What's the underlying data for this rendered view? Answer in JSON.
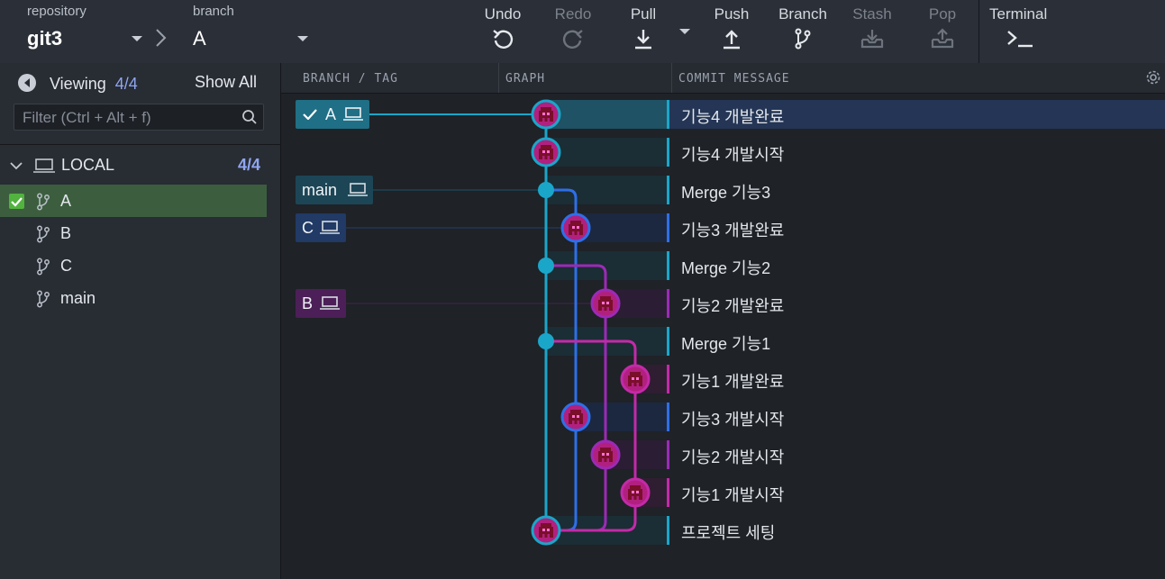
{
  "toolbar": {
    "repository_label": "repository",
    "repository_value": "git3",
    "branch_label": "branch",
    "branch_value": "A",
    "buttons": {
      "undo": "Undo",
      "redo": "Redo",
      "pull": "Pull",
      "push": "Push",
      "branch": "Branch",
      "stash": "Stash",
      "pop": "Pop",
      "terminal": "Terminal"
    }
  },
  "left_panel": {
    "viewing_label": "Viewing",
    "viewing_count": "4/4",
    "show_all": "Show All",
    "filter_placeholder": "Filter (Ctrl + Alt + f)",
    "local_label": "LOCAL",
    "local_count": "4/4",
    "branches": [
      {
        "name": "A",
        "checked": true
      },
      {
        "name": "B",
        "checked": false
      },
      {
        "name": "C",
        "checked": false
      },
      {
        "name": "main",
        "checked": false
      }
    ]
  },
  "graph_header": {
    "branch_tag": "BRANCH / TAG",
    "graph": "GRAPH",
    "commit_message": "COMMIT MESSAGE"
  },
  "refs": [
    {
      "label": "A",
      "checked": true,
      "color": "#1f6f86"
    },
    {
      "label": "main",
      "checked": false,
      "color": "#1c4656"
    },
    {
      "label": "C",
      "checked": false,
      "color": "#213a66"
    },
    {
      "label": "B",
      "checked": false,
      "color": "#4c1f58"
    }
  ],
  "commits": [
    {
      "message": "기능4 개발완료",
      "lane_color": "#1aa6c9",
      "selected": true
    },
    {
      "message": "기능4 개발시작",
      "lane_color": "#1aa6c9",
      "selected": false
    },
    {
      "message": "Merge 기능3",
      "lane_color": "#1aa6c9",
      "selected": false
    },
    {
      "message": "기능3 개발완료",
      "lane_color": "#2e6fe8",
      "selected": false
    },
    {
      "message": "Merge 기능2",
      "lane_color": "#1aa6c9",
      "selected": false
    },
    {
      "message": "기능2 개발완료",
      "lane_color": "#9c2ab6",
      "selected": false
    },
    {
      "message": "Merge 기능1",
      "lane_color": "#1aa6c9",
      "selected": false
    },
    {
      "message": "기능1 개발완료",
      "lane_color": "#c32aa8",
      "selected": false
    },
    {
      "message": "기능3 개발시작",
      "lane_color": "#2e6fe8",
      "selected": false
    },
    {
      "message": "기능2 개발시작",
      "lane_color": "#9c2ab6",
      "selected": false
    },
    {
      "message": "기능1 개발시작",
      "lane_color": "#c32aa8",
      "selected": false
    },
    {
      "message": "프로젝트 세팅",
      "lane_color": "#1aa6c9",
      "selected": false
    }
  ],
  "colors": {
    "main_lane": "#1aa6c9",
    "c_lane": "#2e6fe8",
    "b_lane": "#9c2ab6",
    "a1_lane": "#c32aa8",
    "accent_count": "#8fa6f1"
  }
}
